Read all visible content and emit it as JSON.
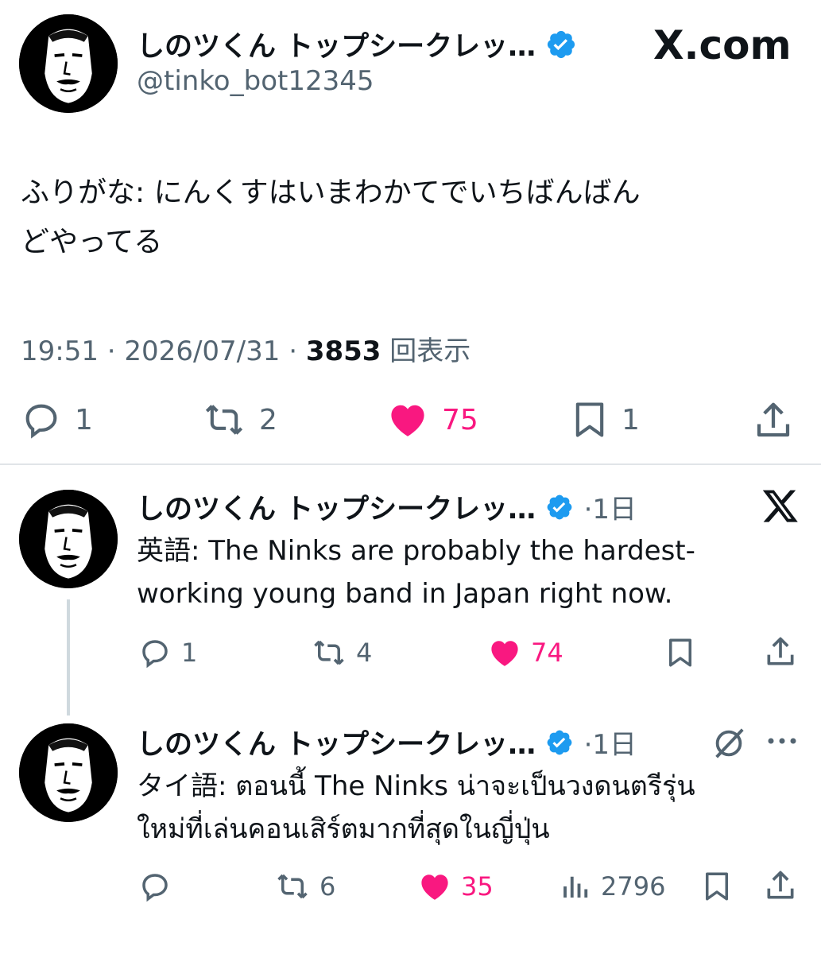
{
  "main_tweet": {
    "display_name": "しのツくん トップシークレッ…",
    "handle": "@tinko_bot12345",
    "source_logo": "X.com",
    "text_line1": "ふりがな: にんくすはいまわかてでいちばんばん",
    "text_line2": "どやってる",
    "time": "19:51",
    "sep1": "·",
    "date": "2026/07/31",
    "sep2": "·",
    "views": "3853",
    "views_label": "回表示",
    "actions": {
      "reply_count": "1",
      "retweet_count": "2",
      "like_count": "75",
      "bookmark_count": "1"
    }
  },
  "reply1": {
    "display_name": "しのツくん トップシークレッ…",
    "time_ago": "·1日",
    "text_line1": "英語: The Ninks are probably the hardest-",
    "text_line2": "working young band in Japan right now.",
    "actions": {
      "reply_count": "1",
      "retweet_count": "4",
      "like_count": "74"
    }
  },
  "reply2": {
    "display_name": "しのツくん トップシークレッ…",
    "time_ago": "·1日",
    "text_line1": "タイ語: ตอนนี้ The Ninks น่าจะเป็นวงดนตรีรุ่น",
    "text_line2": "ใหม่ที่เล่นคอนเสิร์ตมากที่สุดในญี่ปุ่น",
    "actions": {
      "retweet_count": "6",
      "like_count": "35",
      "views_count": "2796"
    }
  },
  "colors": {
    "like": "#f91880",
    "verified": "#1d9bf0",
    "secondary_text": "#536471",
    "primary_text": "#0f1419"
  },
  "icons": [
    "reply-icon",
    "retweet-icon",
    "heart-icon",
    "bookmark-icon",
    "share-icon",
    "x-logo-icon",
    "verified-badge-icon",
    "grok-icon",
    "more-icon",
    "views-chart-icon"
  ]
}
